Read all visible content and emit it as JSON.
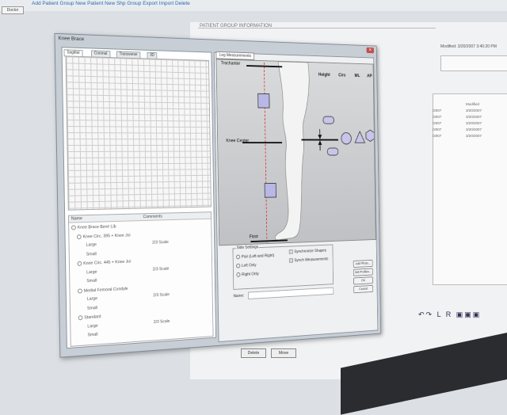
{
  "background": {
    "menu_text": "Add Patient Group   New Patient   New Shp Group   Export   Import   Delete",
    "tab_label": "Doctor",
    "group_title": "PATIENT GROUP INFORMATION",
    "modified_label": "Modified:",
    "modified_value": "3/20/2007 3:40:20 PM",
    "modified_col": "Modified",
    "rows": [
      "3/20/2007",
      "3/20/2007",
      "3/20/2007",
      "3/20/2007",
      "3/20/2007"
    ],
    "side_rows": [
      "/2007",
      "/2007",
      "/2007",
      "/2007",
      "/2007"
    ],
    "delete_label": "Delete",
    "move_label": "Move"
  },
  "dialog": {
    "title": "Knee Brace",
    "tabs": [
      "Sagittal",
      "Coronal",
      "Transverse",
      "3D"
    ],
    "tree_headers": {
      "name": "Name",
      "comments": "Comments"
    },
    "tree": [
      {
        "label": "Knee Brace Base Lib",
        "level": 0
      },
      {
        "label": "Knee Circ. 395 + Knee Joi",
        "level": 1
      },
      {
        "label": "Large",
        "level": 2,
        "scale": "2/3 Scale"
      },
      {
        "label": "Small",
        "level": 2
      },
      {
        "label": "Knee Circ. 445 + Knee Joi",
        "level": 1
      },
      {
        "label": "Large",
        "level": 2,
        "scale": "2/3 Scale"
      },
      {
        "label": "Small",
        "level": 2
      },
      {
        "label": "Medial Femoral Condyle",
        "level": 1
      },
      {
        "label": "Large",
        "level": 2,
        "scale": "2/3 Scale"
      },
      {
        "label": "Small",
        "level": 2
      },
      {
        "label": "Standard",
        "level": 1
      },
      {
        "label": "Large",
        "level": 2,
        "scale": "2/3 Scale"
      },
      {
        "label": "Small",
        "level": 2
      }
    ],
    "right_tab": "Leg Measurements",
    "labels": {
      "trochanter": "Trochanter",
      "knee_center": "Knee Center",
      "floor": "Floor"
    },
    "columns": [
      "Height",
      "Circ",
      "ML",
      "AP"
    ],
    "side_settings": {
      "title": "Side Settings",
      "options": [
        "Pair (Left and Right)",
        "Left Only",
        "Right Only"
      ],
      "checks": [
        "Synchronize Shapes",
        "Synch Measurements"
      ]
    },
    "name_label": "Name:",
    "buttons": [
      "Add Photo...",
      "Set Profiles...",
      "OK",
      "Cancel"
    ]
  },
  "colors": {
    "shape_fill": "#b9b7e6",
    "red_line": "#dd3333"
  }
}
